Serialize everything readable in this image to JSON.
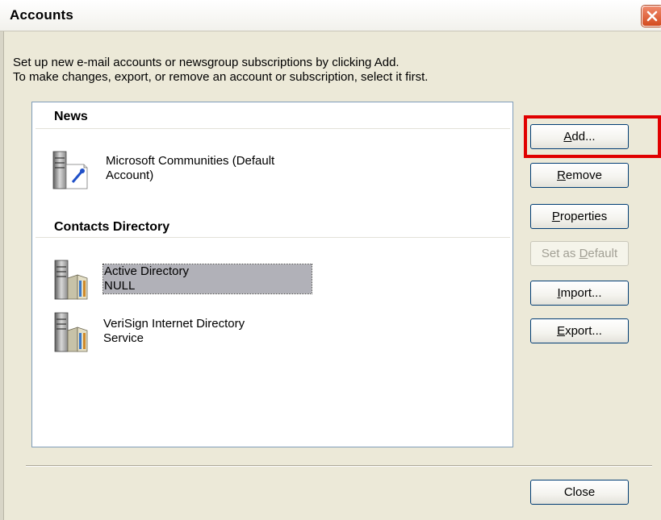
{
  "window": {
    "title": "Accounts"
  },
  "description": {
    "line1": "Set up new e-mail accounts or newsgroup subscriptions by clicking Add.",
    "line2": "To make changes, export, or remove an account or subscription, select it first."
  },
  "groups": [
    {
      "header": "News",
      "accounts": [
        {
          "line1": "Microsoft Communities (Default",
          "line2": "Account)",
          "icon": "news-server-icon",
          "selected": false
        }
      ]
    },
    {
      "header": "Contacts Directory",
      "accounts": [
        {
          "line1": "Active Directory",
          "line2": "NULL",
          "icon": "directory-server-icon",
          "selected": true
        },
        {
          "line1": "VeriSign Internet Directory",
          "line2": "Service",
          "icon": "directory-server-icon",
          "selected": false
        }
      ]
    }
  ],
  "buttons": {
    "add": {
      "pre": "",
      "ul": "A",
      "post": "dd..."
    },
    "remove": {
      "pre": "",
      "ul": "R",
      "post": "emove"
    },
    "properties": {
      "pre": "",
      "ul": "P",
      "post": "roperties"
    },
    "set_default": {
      "pre": "Set as ",
      "ul": "D",
      "post": "efault",
      "enabled": false
    },
    "import": {
      "pre": "",
      "ul": "I",
      "post": "mport..."
    },
    "export": {
      "pre": "",
      "ul": "E",
      "post": "xport..."
    },
    "close": "Close"
  },
  "colors": {
    "highlight": "#e00000",
    "selection": "#b1b1b8"
  }
}
